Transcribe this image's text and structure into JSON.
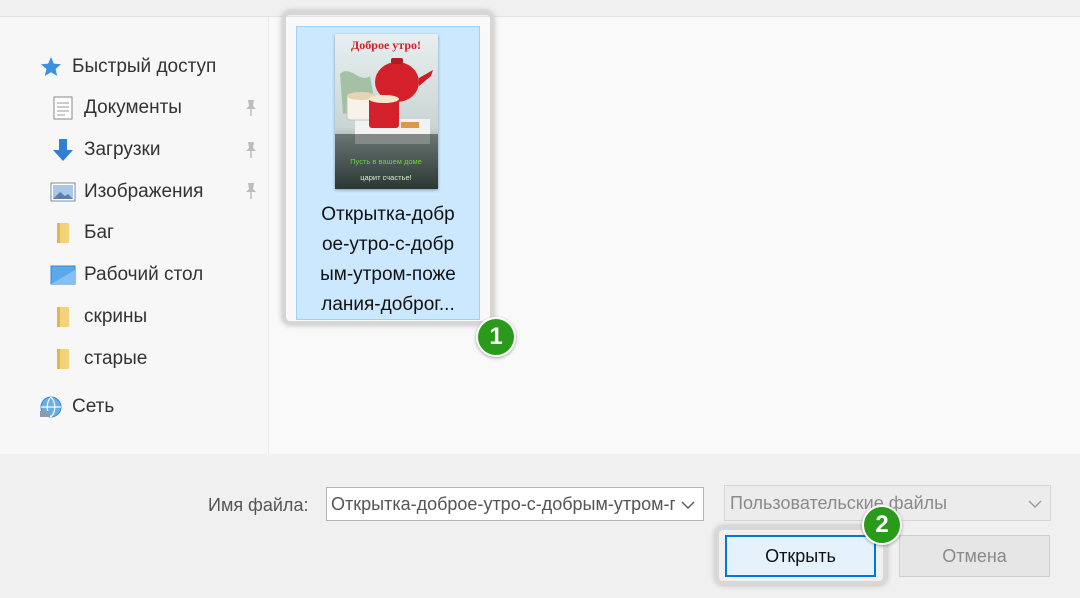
{
  "nav": {
    "items": [
      {
        "label": "Быстрый доступ",
        "icon": "star-icon",
        "pinned": false
      },
      {
        "label": "Документы",
        "icon": "documents-icon",
        "pinned": true
      },
      {
        "label": "Загрузки",
        "icon": "download-arrow-icon",
        "pinned": true
      },
      {
        "label": "Изображения",
        "icon": "pictures-icon",
        "pinned": true
      },
      {
        "label": "Баг",
        "icon": "folder-icon",
        "pinned": false
      },
      {
        "label": "Рабочий стол",
        "icon": "desktop-icon",
        "pinned": false
      },
      {
        "label": "скрины",
        "icon": "folder-icon",
        "pinned": false
      },
      {
        "label": "старые",
        "icon": "folder-icon",
        "pinned": false
      },
      {
        "label": "Сеть",
        "icon": "network-icon",
        "pinned": false
      }
    ]
  },
  "file": {
    "name_lines": [
      "Открытка-добр",
      "ое-утро-с-добр",
      "ым-утром-поже",
      "лания-доброг..."
    ],
    "thumbnail": {
      "title": "Доброе утро!",
      "caption_line1": "Пусть в вашем доме",
      "caption_line2": "царит счастье!"
    }
  },
  "badges": {
    "one": "1",
    "two": "2"
  },
  "bottom": {
    "filename_label": "Имя файла:",
    "filename_value": "Открытка-доброе-утро-с-добрым-утром-пожелания-доброго",
    "filetype_value": "Пользовательские файлы",
    "open_label": "Открыть",
    "cancel_label": "Отмена"
  },
  "colors": {
    "selection": "#cce8ff",
    "selection_border": "#99d1ff",
    "accent": "#0078d7",
    "badge": "#2a9a1a"
  }
}
